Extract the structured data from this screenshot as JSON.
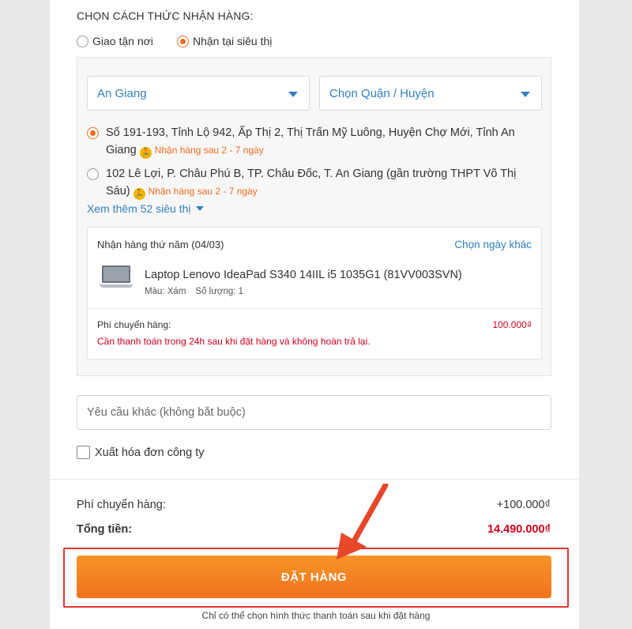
{
  "delivery": {
    "section_title": "CHỌN CÁCH THỨC NHẬN HÀNG:",
    "options": [
      {
        "label": "Giao tận nơi",
        "selected": false
      },
      {
        "label": "Nhận tại siêu thị",
        "selected": true
      }
    ]
  },
  "filters": {
    "province": "An Giang",
    "district_placeholder": "Chọn Quận / Huyện"
  },
  "stores": [
    {
      "address": "Số 191-193, Tỉnh Lộ 942, Ấp Thị 2, Thị Trấn Mỹ Luông, Huyện Chợ Mới, Tỉnh An Giang",
      "eta": "Nhận hàng sau 2 - 7 ngày",
      "selected": true
    },
    {
      "address": "102 Lê Lợi, P. Châu Phú B, TP. Châu Đốc, T. An Giang (gần trường THPT Võ Thị Sáu)",
      "eta": "Nhận hàng sau 2 - 7 ngày",
      "selected": false
    }
  ],
  "see_more_label": "Xem thêm 52 siêu thị",
  "order_card": {
    "pickup_date": "Nhận hàng thứ năm (04/03)",
    "change_date_label": "Chọn ngày khác",
    "product_name": "Laptop Lenovo IdeaPad S340 14IIL i5 1035G1 (81VV003SVN)",
    "color": "Màu: Xám",
    "quantity": "Số lượng: 1",
    "shipping_label": "Phí chuyển hàng:",
    "shipping_fee": "100.000₫",
    "payment_note": "Cần thanh toán trong 24h sau khi đặt hàng và không hoàn trả lại."
  },
  "other_request_placeholder": "Yêu cầu khác (không bắt buộc)",
  "invoice_label": "Xuất hóa đơn công ty",
  "summary": {
    "shipping_label": "Phí chuyển hàng:",
    "shipping_value": "+100.000₫",
    "total_label": "Tổng tiền:",
    "total_value": "14.490.000₫"
  },
  "order_button_label": "ĐẶT HÀNG",
  "payment_method_note": "Chỉ có thể chọn hình thức thanh toán sau khi đặt hàng",
  "colors": {
    "accent_orange": "#f26b21",
    "link_blue": "#2f80c2",
    "price_red": "#d0021b",
    "highlight_red": "#e3342f"
  },
  "icons": [
    "radio-icon",
    "chevron-down-icon",
    "delivery-runner-icon",
    "laptop-thumbnail",
    "checkbox-icon",
    "annotation-arrow-icon"
  ]
}
